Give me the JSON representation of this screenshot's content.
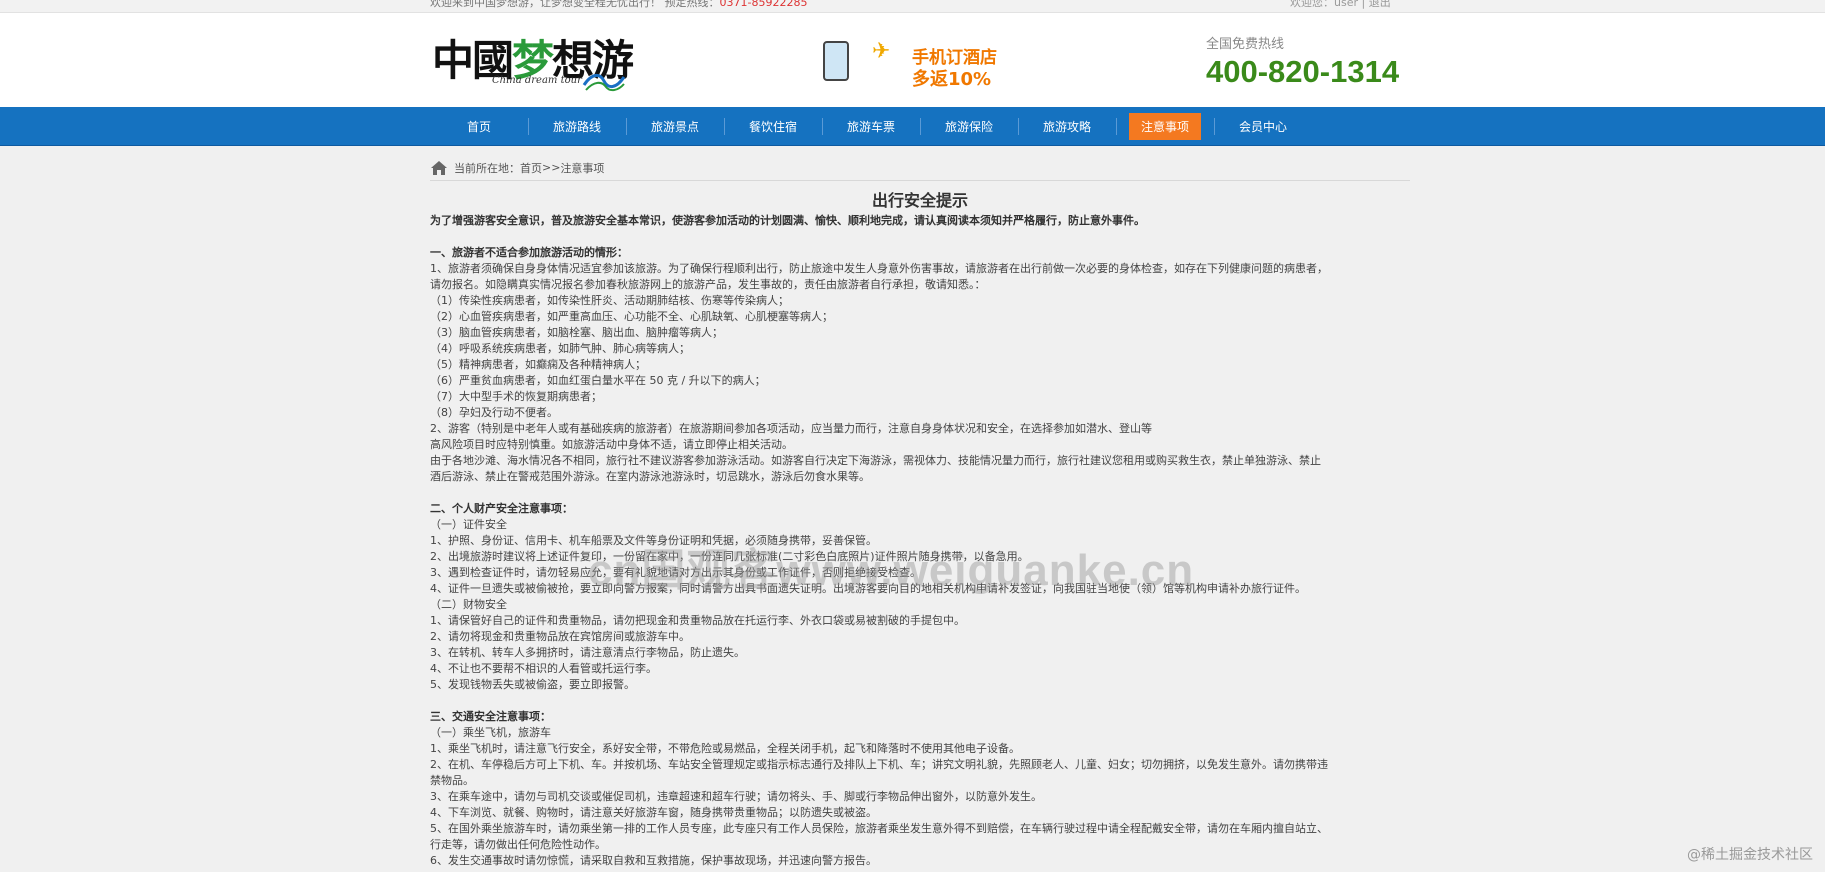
{
  "topbar": {
    "welcome": "欢迎来到中国梦想游，让梦想变全程无忧出行！  预定热线：",
    "phone": "0371-85922285",
    "links": "欢迎您：user | 退出"
  },
  "logo": {
    "text_black": "中國",
    "text_green": "梦",
    "text_rest": "想游",
    "english": "China dream tour"
  },
  "promo": {
    "line1": "手机订酒店",
    "line2": "多返10%"
  },
  "hotline": {
    "label": "全国免费热线",
    "number": "400-820-1314"
  },
  "nav": {
    "items": [
      {
        "label": "首页"
      },
      {
        "label": "旅游路线"
      },
      {
        "label": "旅游景点"
      },
      {
        "label": "餐饮住宿"
      },
      {
        "label": "旅游车票"
      },
      {
        "label": "旅游保险"
      },
      {
        "label": "旅游攻略"
      },
      {
        "label": "注意事项"
      },
      {
        "label": "会员中心"
      }
    ],
    "active_index": 7,
    "active_color": "#f47920",
    "bar_color": "#1572c0"
  },
  "breadcrumb": {
    "prefix": "当前所在地：",
    "home": "首页",
    "sep": " >> ",
    "current": "注意事项"
  },
  "article": {
    "title": "出行安全提示",
    "intro": "为了增强游客安全意识，普及旅游安全基本常识，使游客参加活动的计划圆满、愉快、顺利地完成，请认真阅读本须知并严格履行，防止意外事件。",
    "lines": [
      {
        "t": "",
        "k": "gap"
      },
      {
        "t": "一、旅游者不适合参加旅游活动的情形：",
        "k": "sec"
      },
      {
        "t": "1、旅游者须确保自身身体情况适宜参加该旅游。为了确保行程顺利出行，防止旅途中发生人身意外伤害事故，请旅游者在出行前做一次必要的身体检查，如存在下列健康问题的病患者，",
        "k": "p"
      },
      {
        "t": "请勿报名。如隐瞒真实情况报名参加春秋旅游网上的旅游产品，发生事故的，责任由旅游者自行承担，敬请知悉。：",
        "k": "p"
      },
      {
        "t": "（1）传染性疾病患者，如传染性肝炎、活动期肺结核、伤寒等传染病人；",
        "k": "p"
      },
      {
        "t": "（2）心血管疾病患者，如严重高血压、心功能不全、心肌缺氧、心肌梗塞等病人；",
        "k": "p"
      },
      {
        "t": "（3）脑血管疾病患者，如脑栓塞、脑出血、脑肿瘤等病人；",
        "k": "p"
      },
      {
        "t": "（4）呼吸系统疾病患者，如肺气肿、肺心病等病人；",
        "k": "p"
      },
      {
        "t": "（5）精神病患者，如癫痫及各种精神病人；",
        "k": "p"
      },
      {
        "t": "（6）严重贫血病患者，如血红蛋白量水平在 50 克 / 升以下的病人；",
        "k": "p"
      },
      {
        "t": "（7）大中型手术的恢复期病患者；",
        "k": "p"
      },
      {
        "t": "（8）孕妇及行动不便者。",
        "k": "p"
      },
      {
        "t": "2、游客（特别是中老年人或有基础疾病的旅游者）在旅游期间参加各项活动，应当量力而行，注意自身身体状况和安全，在选择参加如潜水、登山等",
        "k": "p"
      },
      {
        "t": "高风险项目时应特别慎重。如旅游活动中身体不适，请立即停止相关活动。",
        "k": "p"
      },
      {
        "t": "由于各地沙滩、海水情况各不相同，旅行社不建议游客参加游泳活动。如游客自行决定下海游泳，需视体力、技能情况量力而行，旅行社建议您租用或购买救生衣，禁止单独游泳、禁止",
        "k": "p"
      },
      {
        "t": "酒后游泳、禁止在警戒范围外游泳。在室内游泳池游泳时，切忌跳水，游泳后勿食水果等。",
        "k": "p"
      },
      {
        "t": "",
        "k": "gap"
      },
      {
        "t": "二、个人财产安全注意事项：",
        "k": "sec"
      },
      {
        "t": "（一）证件安全",
        "k": "p"
      },
      {
        "t": "1、护照、身份证、信用卡、机车船票及文件等身份证明和凭据，必须随身携带，妥善保管。",
        "k": "p"
      },
      {
        "t": "2、出境旅游时建议将上述证件复印，一份留在家中，一份连同几张标准(二寸彩色白底照片)证件照片随身携带，以备急用。",
        "k": "p"
      },
      {
        "t": "3、遇到检查证件时，请勿轻易应允，要有礼貌地请对方出示其身份或工作证件，否则拒绝接受检查。",
        "k": "p"
      },
      {
        "t": "4、证件一旦遗失或被偷被抢，要立即向警方报案，同时请警方出具书面遗失证明。出境游客要向目的地相关机构申请补发签证，向我国驻当地使（领）馆等机构申请补办旅行证件。",
        "k": "p"
      },
      {
        "t": "（二）财物安全",
        "k": "p"
      },
      {
        "t": "1、请保管好自己的证件和贵重物品，请勿把现金和贵重物品放在托运行李、外衣口袋或易被割破的手提包中。",
        "k": "p"
      },
      {
        "t": "2、请勿将现金和贵重物品放在宾馆房间或旅游车中。",
        "k": "p"
      },
      {
        "t": "3、在转机、转车人多拥挤时，请注意清点行李物品，防止遗失。",
        "k": "p"
      },
      {
        "t": "4、不让也不要帮不相识的人看管或托运行李。",
        "k": "p"
      },
      {
        "t": "5、发现钱物丢失或被偷盗，要立即报警。",
        "k": "p"
      },
      {
        "t": "",
        "k": "gap"
      },
      {
        "t": "三、交通安全注意事项：",
        "k": "sec"
      },
      {
        "t": "（一）乘坐飞机，旅游车",
        "k": "p"
      },
      {
        "t": "1、乘坐飞机时，请注意飞行安全，系好安全带，不带危险或易燃品，全程关闭手机，起飞和降落时不使用其他电子设备。",
        "k": "p"
      },
      {
        "t": "2、在机、车停稳后方可上下机、车。并按机场、车站安全管理规定或指示标志通行及排队上下机、车；讲究文明礼貌，先照顾老人、儿童、妇女；切勿拥挤，以免发生意外。请勿携带违",
        "k": "p"
      },
      {
        "t": "禁物品。",
        "k": "p"
      },
      {
        "t": "3、在乘车途中，请勿与司机交谈或催促司机，违章超速和超车行驶；请勿将头、手、脚或行李物品伸出窗外，以防意外发生。",
        "k": "p"
      },
      {
        "t": "4、下车浏览、就餐、购物时，请注意关好旅游车窗，随身携带贵重物品；以防遗失或被盗。",
        "k": "p"
      },
      {
        "t": "5、在国外乘坐旅游车时，请勿乘坐第一排的工作人员专座，此专座只有工作人员保险，旅游者乘坐发生意外得不到赔偿，在车辆行驶过程中请全程配戴安全带，请勿在车厢内擅自站立、",
        "k": "p"
      },
      {
        "t": "行走等，请勿做出任何危险性动作。",
        "k": "p"
      },
      {
        "t": "6、发生交通事故时请勿惊慌，请采取自救和互救措施，保护事故现场，并迅速向警方报告。",
        "k": "p"
      }
    ]
  },
  "watermark": "cn国观客www.weiguanke.cn",
  "footer_watermark": "@稀土掘金技术社区"
}
